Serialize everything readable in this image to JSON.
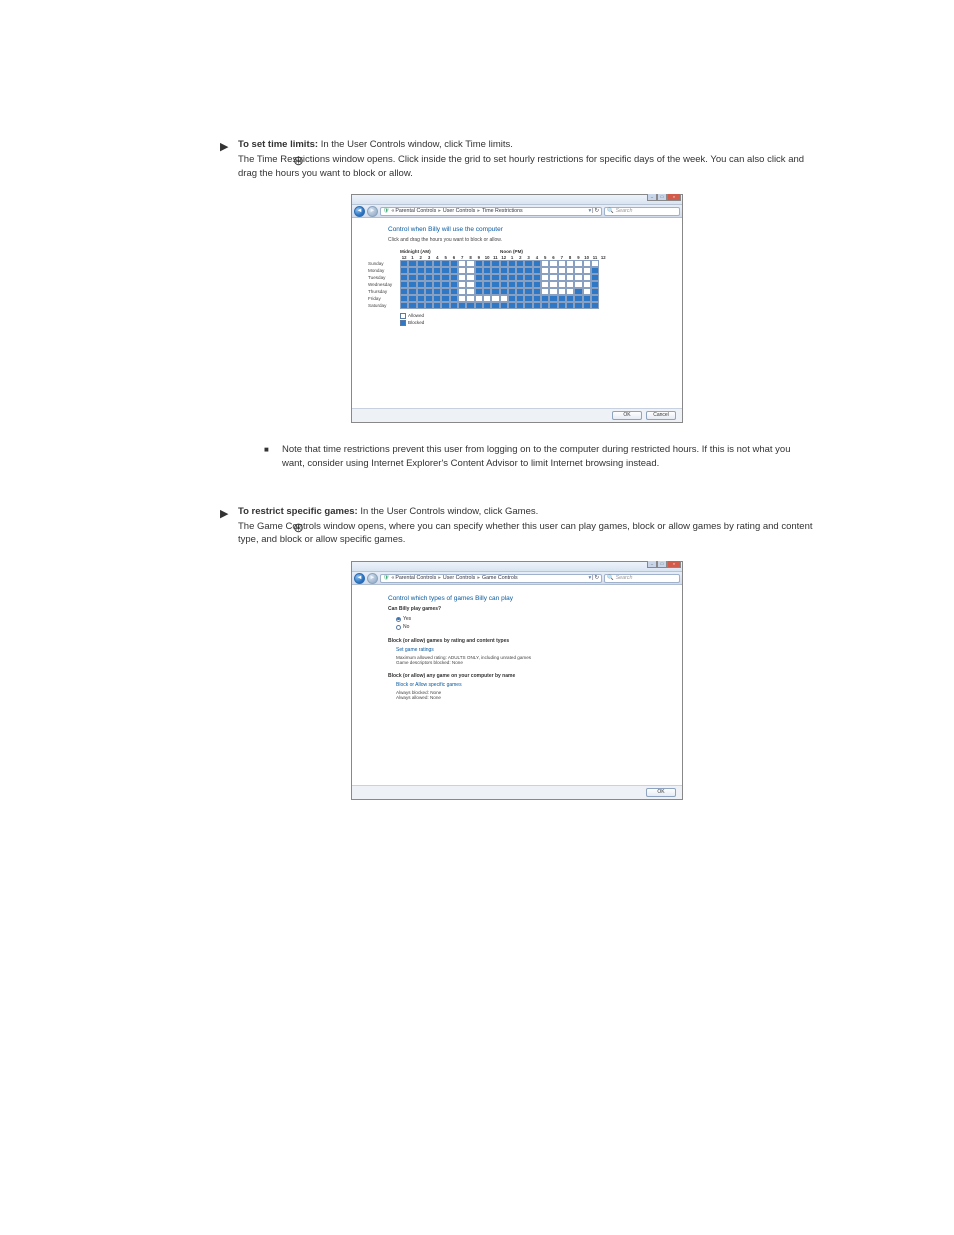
{
  "steps": {
    "time": {
      "label": "To set time limits:",
      "head": " In the User Controls window, click Time limits.",
      "desc": "The Time Restrictions window opens. Click inside the grid to set hourly restrictions for specific days of the week. You can also click and drag the hours you want to block or allow."
    },
    "games": {
      "label": "To restrict specific games:",
      "head": " In the User Controls window, click Games.",
      "desc": "The Game Controls window opens, where you can specify whether this user can play games, block or allow games by rating and content type, and block or allow specific games."
    }
  },
  "note": {
    "text": "Note that time restrictions prevent this user from logging on to the computer during restricted hours. If this is not what you want, consider using Internet Explorer's Content Advisor to limit Internet browsing instead."
  },
  "window_common": {
    "search_placeholder": "Search",
    "ok": "OK",
    "cancel": "Cancel",
    "breadcrumb": {
      "pc": "Parental Controls",
      "uc": "User Controls",
      "tr": "Time Restrictions",
      "gc": "Game Controls"
    }
  },
  "time_window": {
    "title": "Control when Billy will use the computer",
    "subtitle": "Click and drag the hours you want to block or allow.",
    "axis_midnight": "Midnight (AM)",
    "axis_noon": "Noon (PM)",
    "hours": [
      "12",
      "1",
      "2",
      "3",
      "4",
      "5",
      "6",
      "7",
      "8",
      "9",
      "10",
      "11",
      "12",
      "1",
      "2",
      "3",
      "4",
      "5",
      "6",
      "7",
      "8",
      "9",
      "10",
      "11",
      "12"
    ],
    "days": [
      "Sunday",
      "Monday",
      "Tuesday",
      "Wednesday",
      "Thursday",
      "Friday",
      "Saturday"
    ],
    "legend_allowed": "Allowed",
    "legend_blocked": "Blocked",
    "grid": [
      "bbbbbbbaabbbbbbbbaaaaaaa",
      "bbbbbbbaabbbbbbbbaaaaaab",
      "bbbbbbbaabbbbbbbbaaaaaab",
      "bbbbbbbaabbbbbbbbaaaaaab",
      "bbbbbbbaabbbbbbbbaaaababb",
      "bbbbbbbaaaaaabbbbbbbbbbbb",
      "bbbbbbbbbbbbbbbbbbbbbbbb"
    ]
  },
  "game_window": {
    "title": "Control which types of games Billy can play",
    "q1": "Can Billy play games?",
    "opt_yes": "Yes",
    "opt_no": "No",
    "sect_ratings": "Block (or allow) games by rating and content types",
    "link_ratings": "Set game ratings",
    "ratings_line1": "Maximum allowed rating:  ADULTS ONLY, including unrated games",
    "ratings_line2": "Game descriptors blocked:  None",
    "sect_specific": "Block (or allow) any game on your computer by name",
    "link_specific": "Block or Allow specific games",
    "spec_line1": "Always blocked:  None",
    "spec_line2": "Always allowed:  None"
  }
}
